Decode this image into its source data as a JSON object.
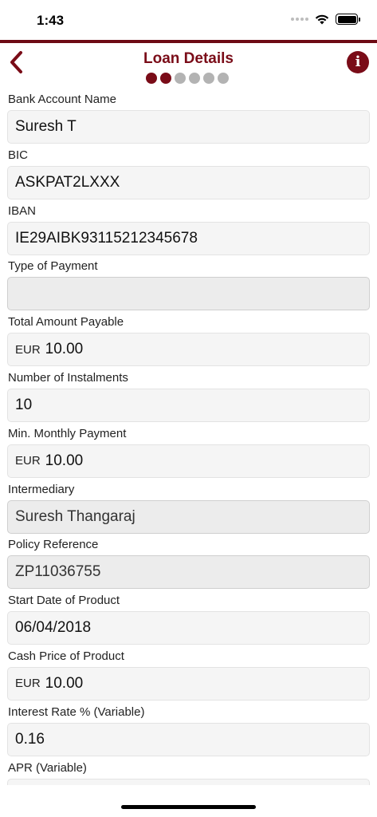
{
  "status": {
    "time": "1:43"
  },
  "header": {
    "title": "Loan Details",
    "steps_total": 6,
    "steps_completed": 2,
    "info_glyph": "i"
  },
  "accent_color": "#7a0c18",
  "form": {
    "bank_account_name": {
      "label": "Bank Account Name",
      "value": "Suresh T"
    },
    "bic": {
      "label": "BIC",
      "value": "ASKPAT2LXXX"
    },
    "iban": {
      "label": "IBAN",
      "value": "IE29AIBK93115212345678"
    },
    "type_of_payment": {
      "label": "Type of Payment",
      "value": ""
    },
    "total_amount_payable": {
      "label": "Total Amount Payable",
      "currency": "EUR",
      "value": "10.00"
    },
    "number_of_instalments": {
      "label": "Number of Instalments",
      "value": "10"
    },
    "min_monthly_payment": {
      "label": "Min. Monthly Payment",
      "currency": "EUR",
      "value": "10.00"
    },
    "intermediary": {
      "label": "Intermediary",
      "value": "Suresh Thangaraj"
    },
    "policy_reference": {
      "label": "Policy Reference",
      "value": "ZP11036755"
    },
    "start_date_of_product": {
      "label": "Start Date of Product",
      "value": "06/04/2018"
    },
    "cash_price_of_product": {
      "label": "Cash Price of Product",
      "currency": "EUR",
      "value": "10.00"
    },
    "interest_rate": {
      "label": "Interest Rate % (Variable)",
      "value": "0.16"
    },
    "apr": {
      "label": "APR (Variable)",
      "value": ""
    }
  }
}
